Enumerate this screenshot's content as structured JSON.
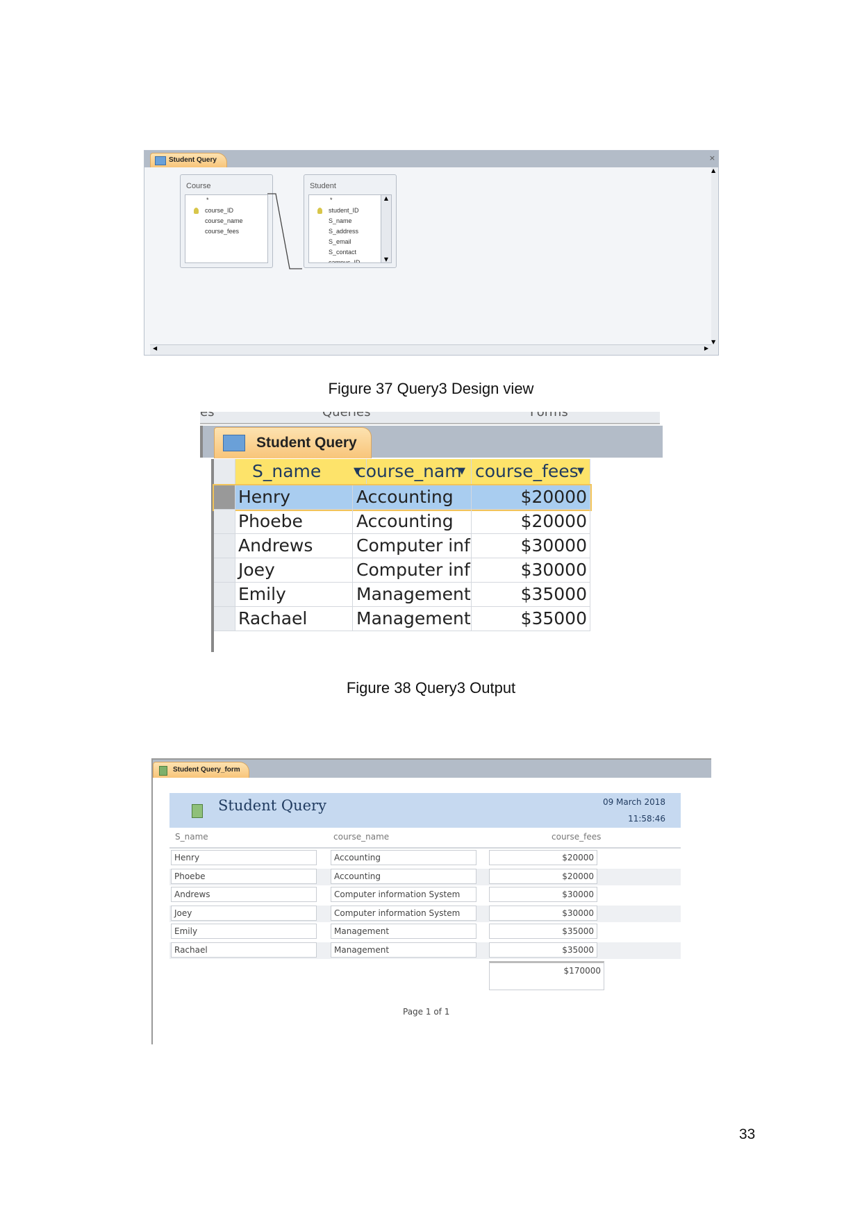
{
  "figure37": {
    "tab_title": "Student Query",
    "tables": [
      {
        "name": "Course",
        "fields": [
          "*",
          "course_ID",
          "course_name",
          "course_fees"
        ],
        "key_field": "course_ID"
      },
      {
        "name": "Student",
        "fields": [
          "*",
          "student_ID",
          "S_name",
          "S_address",
          "S_email",
          "S_contact",
          "campus_ID"
        ],
        "key_field": "student_ID"
      }
    ],
    "caption": "Figure 37 Query3 Design view"
  },
  "figure38": {
    "nav_tabs": [
      "es",
      "Queries",
      "Forms"
    ],
    "tab_title": "Student Query",
    "columns": [
      "S_name",
      "course_nam",
      "course_fees"
    ],
    "rows": [
      [
        "Henry",
        "Accounting",
        "$20000"
      ],
      [
        "Phoebe",
        "Accounting",
        "$20000"
      ],
      [
        "Andrews",
        "Computer infor",
        "$30000"
      ],
      [
        "Joey",
        "Computer infor",
        "$30000"
      ],
      [
        "Emily",
        "Management",
        "$35000"
      ],
      [
        "Rachael",
        "Management",
        "$35000"
      ]
    ],
    "caption": "Figure 38 Query3 Output"
  },
  "figure39": {
    "tab_title": "Student Query_form",
    "header_title": "Student Query",
    "date": "09 March 2018",
    "time": "11:58:46",
    "columns": [
      "S_name",
      "course_name",
      "course_fees"
    ],
    "rows": [
      [
        "Henry",
        "Accounting",
        "$20000"
      ],
      [
        "Phoebe",
        "Accounting",
        "$20000"
      ],
      [
        "Andrews",
        "Computer information System",
        "$30000"
      ],
      [
        "Joey",
        "Computer information System",
        "$30000"
      ],
      [
        "Emily",
        "Management",
        "$35000"
      ],
      [
        "Rachael",
        "Management",
        "$35000"
      ]
    ],
    "total": "$170000",
    "page_label": "Page 1 of 1"
  },
  "page_number": "33",
  "colors": {
    "tab_orange": "#f8c57a",
    "selected_row": "#a9cdf0",
    "header_yellow": "#fde36a",
    "form_header": "#c6d9f0"
  }
}
